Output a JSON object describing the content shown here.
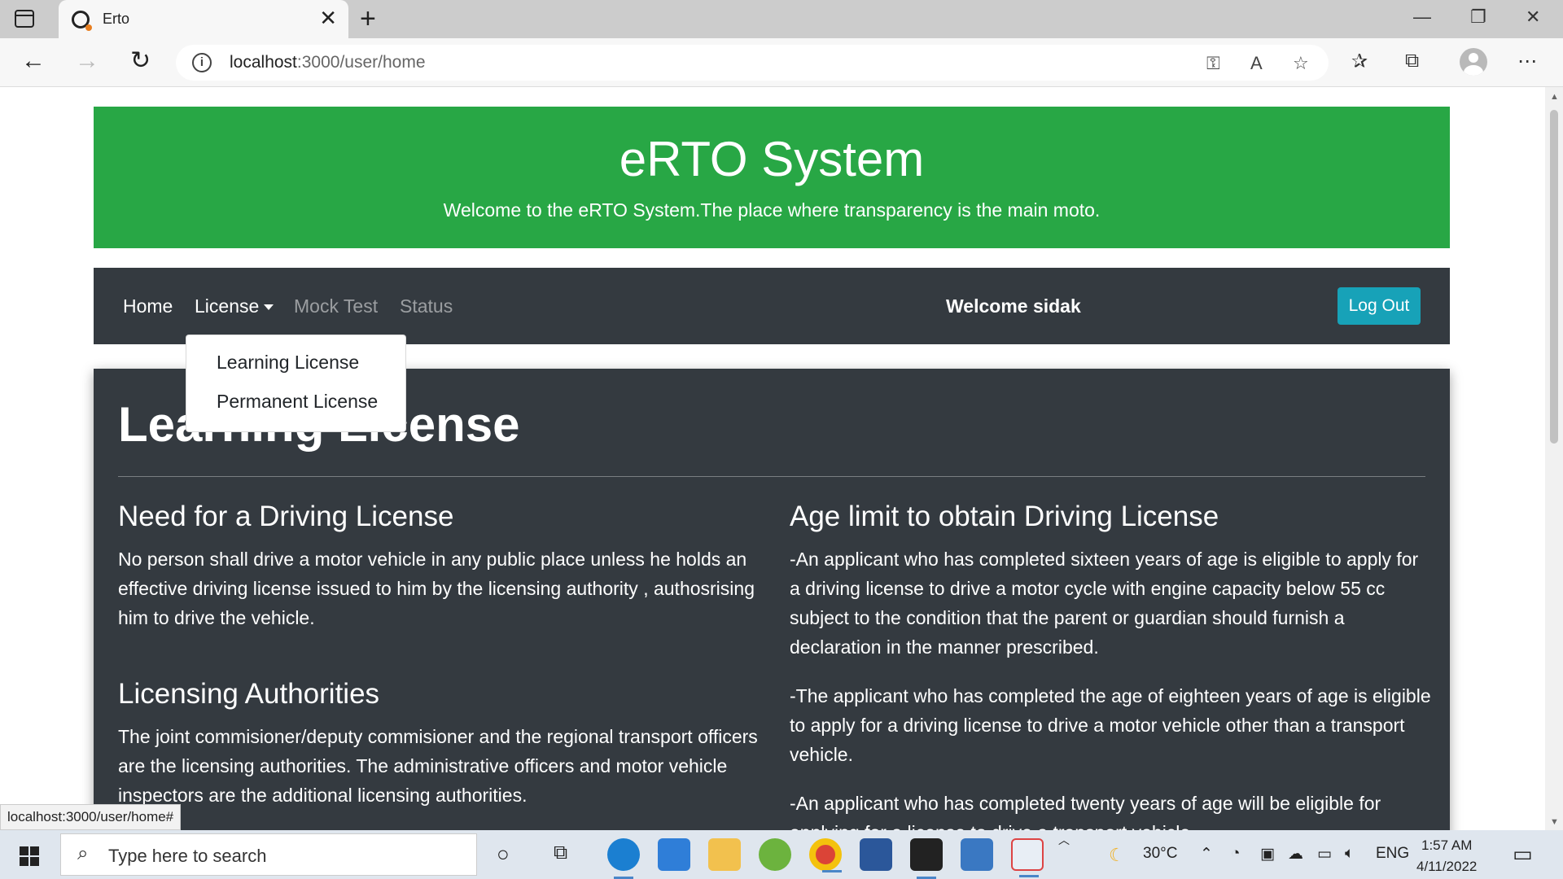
{
  "browser": {
    "tab_title": "Erto",
    "tab_close": "✕",
    "new_tab": "+",
    "url_host": "localhost",
    "url_rest": ":3000/user/home",
    "status_url": "localhost:3000/user/home#"
  },
  "header": {
    "title": "eRTO System",
    "subtitle": "Welcome to the eRTO System.The place where transparency is the main moto."
  },
  "navbar": {
    "home": "Home",
    "license": "License",
    "mock_test": "Mock Test",
    "status": "Status",
    "welcome": "Welcome sidak",
    "logout": "Log Out"
  },
  "dropdown": {
    "items": [
      "Learning License",
      "Permanent License"
    ]
  },
  "content": {
    "title": "Learning License",
    "left": {
      "need_heading": "Need for a Driving License",
      "need_text": "No person shall drive a motor vehicle in any public place unless he holds an effective driving license issued to him by the licensing authority , authosrising him to drive the vehicle.",
      "auth_heading": "Licensing Authorities",
      "auth_text": "The joint commisioner/deputy commisioner and the regional transport officers are the licensing authorities. The administrative officers and motor vehicle inspectors are the additional licensing authorities."
    },
    "right": {
      "age_heading": "Age limit to obtain Driving License",
      "para1": "-An applicant who has completed sixteen years of age is eligible to apply for a driving license to drive a motor cycle with engine capacity below 55 cc subject to the condition that the parent or guardian should furnish a declaration in the manner prescribed.",
      "para2": "-The applicant who has completed the age of eighteen years of age is eligible to apply for a driving license to drive a motor vehicle other than a transport vehicle.",
      "para3": "-An applicant who has completed twenty years of age will be eligible for applying for a license to drive a transport vehicle."
    }
  },
  "taskbar": {
    "search_placeholder": "Type here to search",
    "weather": "30°C",
    "language": "ENG",
    "time": "1:57 AM",
    "date": "4/11/2022"
  },
  "colors": {
    "jumbotron": "#28a745",
    "navbar": "#343a40",
    "logout": "#17a2b8"
  }
}
